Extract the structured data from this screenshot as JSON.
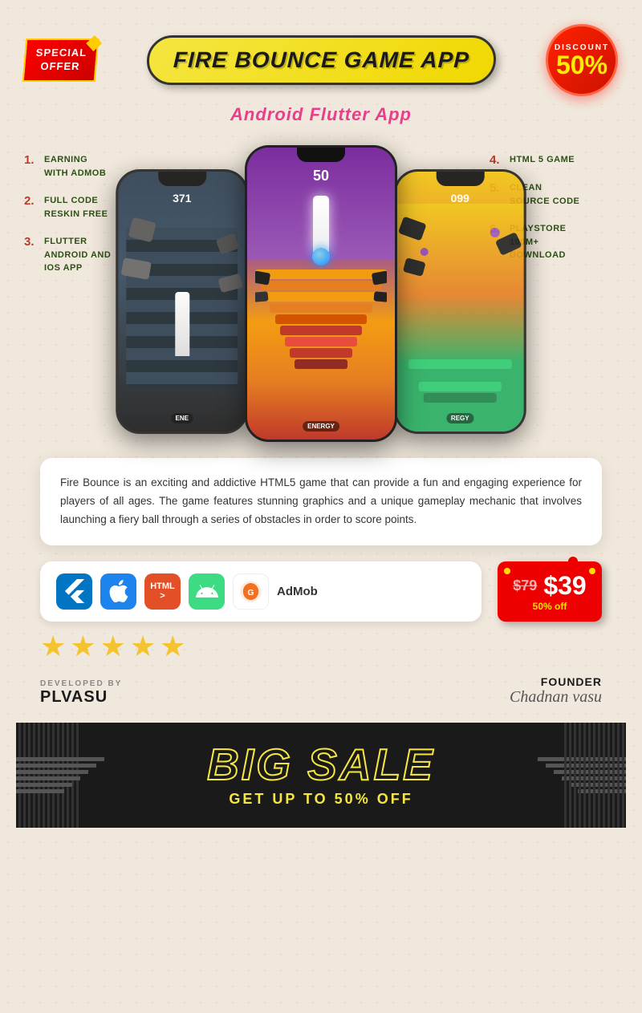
{
  "header": {
    "special_offer": "SPECIAL\nOFFER",
    "title": "FIRE BOUNCE GAME APP",
    "discount_label": "DISCOUNT",
    "discount_pct": "50%",
    "subtitle": "Android Flutter App"
  },
  "features_left": [
    {
      "number": "1.",
      "text": "EARNING\nWITH ADMOB"
    },
    {
      "number": "2.",
      "text": "FULL CODE\nRESKIN FREE"
    },
    {
      "number": "3.",
      "text": "FLUTTER\nANDROID AND\nIOS APP"
    }
  ],
  "features_right": [
    {
      "number": "4.",
      "text": "HTML 5 GAME"
    },
    {
      "number": "5.",
      "text": "CLEAN\nSOURCE CODE"
    },
    {
      "number": "6.",
      "text": "PLAYSTORE\n100M+\nDOWNLOAD"
    }
  ],
  "phone_scores": {
    "left": "371",
    "center": "50",
    "right": "099"
  },
  "description": "Fire Bounce is an exciting and addictive HTML5 game that can provide a fun and engaging experience for players of all ages. The game features stunning graphics and a unique gameplay mechanic that involves launching a fiery ball through a series of obstacles in order to score points.",
  "tech_icons": [
    {
      "name": "Flutter",
      "icon": "F",
      "color": "#0175c2"
    },
    {
      "name": "App Store",
      "icon": "A",
      "color": "#1d84ed"
    },
    {
      "name": "HTML5",
      "icon": "</>",
      "color": "#e34f26"
    },
    {
      "name": "Android",
      "icon": "A",
      "color": "#3ddc84"
    },
    {
      "name": "AdMob",
      "icon": "○",
      "color": "#f47021"
    }
  ],
  "admob_label": "AdMob",
  "stars_count": 5,
  "pricing": {
    "old_price": "$79",
    "new_price": "$39",
    "off_label": "50% off"
  },
  "developer": {
    "dev_by_label": "DEVELOPED BY",
    "dev_name": "PLVASU",
    "founder_label": "FOUNDER",
    "founder_name": "Chadnan vasu"
  },
  "bottom_banner": {
    "big_sale": "BIG SALE",
    "tagline": "GET UP TO 50% OFF"
  }
}
